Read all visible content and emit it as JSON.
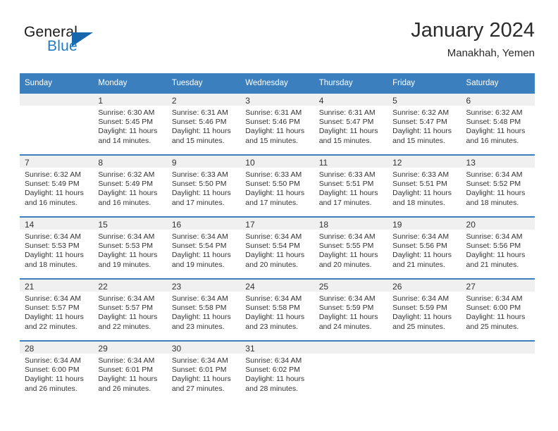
{
  "brand": {
    "name_part1": "General",
    "name_part2": "Blue",
    "triangle_color": "#1667ad",
    "blue_color": "#1f7bc1"
  },
  "header": {
    "title": "January 2024",
    "subtitle": "Manakhah, Yemen"
  },
  "theme": {
    "header_bg": "#3c7fbe",
    "daynum_bg": "#f0f0f0",
    "text": "#333333"
  },
  "weekday_headers": [
    "Sunday",
    "Monday",
    "Tuesday",
    "Wednesday",
    "Thursday",
    "Friday",
    "Saturday"
  ],
  "labels": {
    "sunrise_prefix": "Sunrise:",
    "sunset_prefix": "Sunset:",
    "daylight_prefix": "Daylight:"
  },
  "weeks": [
    [
      {
        "day": "",
        "sunrise": "",
        "sunset": "",
        "daylight_line1": "",
        "daylight_line2": ""
      },
      {
        "day": "1",
        "sunrise": "Sunrise: 6:30 AM",
        "sunset": "Sunset: 5:45 PM",
        "daylight_line1": "Daylight: 11 hours",
        "daylight_line2": "and 14 minutes."
      },
      {
        "day": "2",
        "sunrise": "Sunrise: 6:31 AM",
        "sunset": "Sunset: 5:46 PM",
        "daylight_line1": "Daylight: 11 hours",
        "daylight_line2": "and 15 minutes."
      },
      {
        "day": "3",
        "sunrise": "Sunrise: 6:31 AM",
        "sunset": "Sunset: 5:46 PM",
        "daylight_line1": "Daylight: 11 hours",
        "daylight_line2": "and 15 minutes."
      },
      {
        "day": "4",
        "sunrise": "Sunrise: 6:31 AM",
        "sunset": "Sunset: 5:47 PM",
        "daylight_line1": "Daylight: 11 hours",
        "daylight_line2": "and 15 minutes."
      },
      {
        "day": "5",
        "sunrise": "Sunrise: 6:32 AM",
        "sunset": "Sunset: 5:47 PM",
        "daylight_line1": "Daylight: 11 hours",
        "daylight_line2": "and 15 minutes."
      },
      {
        "day": "6",
        "sunrise": "Sunrise: 6:32 AM",
        "sunset": "Sunset: 5:48 PM",
        "daylight_line1": "Daylight: 11 hours",
        "daylight_line2": "and 16 minutes."
      }
    ],
    [
      {
        "day": "7",
        "sunrise": "Sunrise: 6:32 AM",
        "sunset": "Sunset: 5:49 PM",
        "daylight_line1": "Daylight: 11 hours",
        "daylight_line2": "and 16 minutes."
      },
      {
        "day": "8",
        "sunrise": "Sunrise: 6:32 AM",
        "sunset": "Sunset: 5:49 PM",
        "daylight_line1": "Daylight: 11 hours",
        "daylight_line2": "and 16 minutes."
      },
      {
        "day": "9",
        "sunrise": "Sunrise: 6:33 AM",
        "sunset": "Sunset: 5:50 PM",
        "daylight_line1": "Daylight: 11 hours",
        "daylight_line2": "and 17 minutes."
      },
      {
        "day": "10",
        "sunrise": "Sunrise: 6:33 AM",
        "sunset": "Sunset: 5:50 PM",
        "daylight_line1": "Daylight: 11 hours",
        "daylight_line2": "and 17 minutes."
      },
      {
        "day": "11",
        "sunrise": "Sunrise: 6:33 AM",
        "sunset": "Sunset: 5:51 PM",
        "daylight_line1": "Daylight: 11 hours",
        "daylight_line2": "and 17 minutes."
      },
      {
        "day": "12",
        "sunrise": "Sunrise: 6:33 AM",
        "sunset": "Sunset: 5:51 PM",
        "daylight_line1": "Daylight: 11 hours",
        "daylight_line2": "and 18 minutes."
      },
      {
        "day": "13",
        "sunrise": "Sunrise: 6:34 AM",
        "sunset": "Sunset: 5:52 PM",
        "daylight_line1": "Daylight: 11 hours",
        "daylight_line2": "and 18 minutes."
      }
    ],
    [
      {
        "day": "14",
        "sunrise": "Sunrise: 6:34 AM",
        "sunset": "Sunset: 5:53 PM",
        "daylight_line1": "Daylight: 11 hours",
        "daylight_line2": "and 18 minutes."
      },
      {
        "day": "15",
        "sunrise": "Sunrise: 6:34 AM",
        "sunset": "Sunset: 5:53 PM",
        "daylight_line1": "Daylight: 11 hours",
        "daylight_line2": "and 19 minutes."
      },
      {
        "day": "16",
        "sunrise": "Sunrise: 6:34 AM",
        "sunset": "Sunset: 5:54 PM",
        "daylight_line1": "Daylight: 11 hours",
        "daylight_line2": "and 19 minutes."
      },
      {
        "day": "17",
        "sunrise": "Sunrise: 6:34 AM",
        "sunset": "Sunset: 5:54 PM",
        "daylight_line1": "Daylight: 11 hours",
        "daylight_line2": "and 20 minutes."
      },
      {
        "day": "18",
        "sunrise": "Sunrise: 6:34 AM",
        "sunset": "Sunset: 5:55 PM",
        "daylight_line1": "Daylight: 11 hours",
        "daylight_line2": "and 20 minutes."
      },
      {
        "day": "19",
        "sunrise": "Sunrise: 6:34 AM",
        "sunset": "Sunset: 5:56 PM",
        "daylight_line1": "Daylight: 11 hours",
        "daylight_line2": "and 21 minutes."
      },
      {
        "day": "20",
        "sunrise": "Sunrise: 6:34 AM",
        "sunset": "Sunset: 5:56 PM",
        "daylight_line1": "Daylight: 11 hours",
        "daylight_line2": "and 21 minutes."
      }
    ],
    [
      {
        "day": "21",
        "sunrise": "Sunrise: 6:34 AM",
        "sunset": "Sunset: 5:57 PM",
        "daylight_line1": "Daylight: 11 hours",
        "daylight_line2": "and 22 minutes."
      },
      {
        "day": "22",
        "sunrise": "Sunrise: 6:34 AM",
        "sunset": "Sunset: 5:57 PM",
        "daylight_line1": "Daylight: 11 hours",
        "daylight_line2": "and 22 minutes."
      },
      {
        "day": "23",
        "sunrise": "Sunrise: 6:34 AM",
        "sunset": "Sunset: 5:58 PM",
        "daylight_line1": "Daylight: 11 hours",
        "daylight_line2": "and 23 minutes."
      },
      {
        "day": "24",
        "sunrise": "Sunrise: 6:34 AM",
        "sunset": "Sunset: 5:58 PM",
        "daylight_line1": "Daylight: 11 hours",
        "daylight_line2": "and 23 minutes."
      },
      {
        "day": "25",
        "sunrise": "Sunrise: 6:34 AM",
        "sunset": "Sunset: 5:59 PM",
        "daylight_line1": "Daylight: 11 hours",
        "daylight_line2": "and 24 minutes."
      },
      {
        "day": "26",
        "sunrise": "Sunrise: 6:34 AM",
        "sunset": "Sunset: 5:59 PM",
        "daylight_line1": "Daylight: 11 hours",
        "daylight_line2": "and 25 minutes."
      },
      {
        "day": "27",
        "sunrise": "Sunrise: 6:34 AM",
        "sunset": "Sunset: 6:00 PM",
        "daylight_line1": "Daylight: 11 hours",
        "daylight_line2": "and 25 minutes."
      }
    ],
    [
      {
        "day": "28",
        "sunrise": "Sunrise: 6:34 AM",
        "sunset": "Sunset: 6:00 PM",
        "daylight_line1": "Daylight: 11 hours",
        "daylight_line2": "and 26 minutes."
      },
      {
        "day": "29",
        "sunrise": "Sunrise: 6:34 AM",
        "sunset": "Sunset: 6:01 PM",
        "daylight_line1": "Daylight: 11 hours",
        "daylight_line2": "and 26 minutes."
      },
      {
        "day": "30",
        "sunrise": "Sunrise: 6:34 AM",
        "sunset": "Sunset: 6:01 PM",
        "daylight_line1": "Daylight: 11 hours",
        "daylight_line2": "and 27 minutes."
      },
      {
        "day": "31",
        "sunrise": "Sunrise: 6:34 AM",
        "sunset": "Sunset: 6:02 PM",
        "daylight_line1": "Daylight: 11 hours",
        "daylight_line2": "and 28 minutes."
      },
      {
        "day": "",
        "sunrise": "",
        "sunset": "",
        "daylight_line1": "",
        "daylight_line2": ""
      },
      {
        "day": "",
        "sunrise": "",
        "sunset": "",
        "daylight_line1": "",
        "daylight_line2": ""
      },
      {
        "day": "",
        "sunrise": "",
        "sunset": "",
        "daylight_line1": "",
        "daylight_line2": ""
      }
    ]
  ]
}
